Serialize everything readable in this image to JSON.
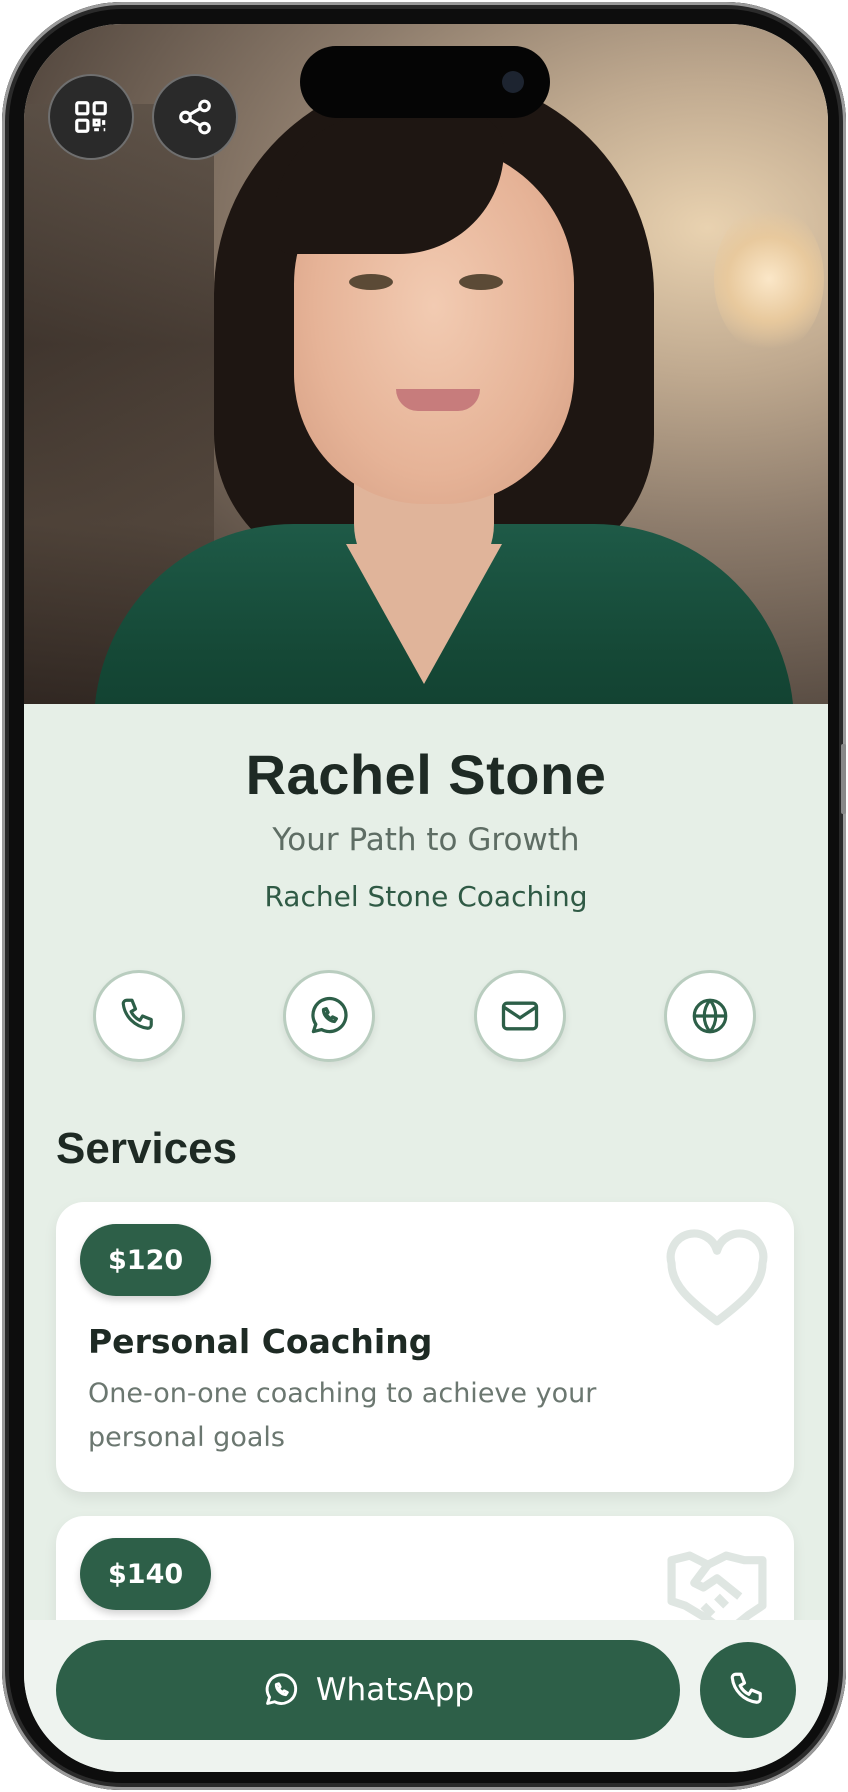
{
  "profile": {
    "name": "Rachel Stone",
    "tagline": "Your Path to Growth",
    "company": "Rachel Stone Coaching"
  },
  "top_actions": [
    {
      "icon": "qr-code-icon"
    },
    {
      "icon": "share-icon"
    }
  ],
  "contact_actions": [
    {
      "icon": "phone-icon"
    },
    {
      "icon": "whatsapp-icon"
    },
    {
      "icon": "mail-icon"
    },
    {
      "icon": "globe-icon"
    }
  ],
  "services": {
    "title": "Services",
    "items": [
      {
        "price": "$120",
        "title": "Personal Coaching",
        "description": "One-on-one coaching to achieve your personal goals",
        "icon": "heart-icon"
      },
      {
        "price": "$140",
        "title": "",
        "description": "",
        "icon": "handshake-icon"
      }
    ]
  },
  "bottom_bar": {
    "whatsapp_label": "WhatsApp",
    "call_icon": "phone-icon"
  },
  "colors": {
    "accent": "#2d5f48",
    "background": "#e6efe7",
    "text": "#1e2a24"
  }
}
